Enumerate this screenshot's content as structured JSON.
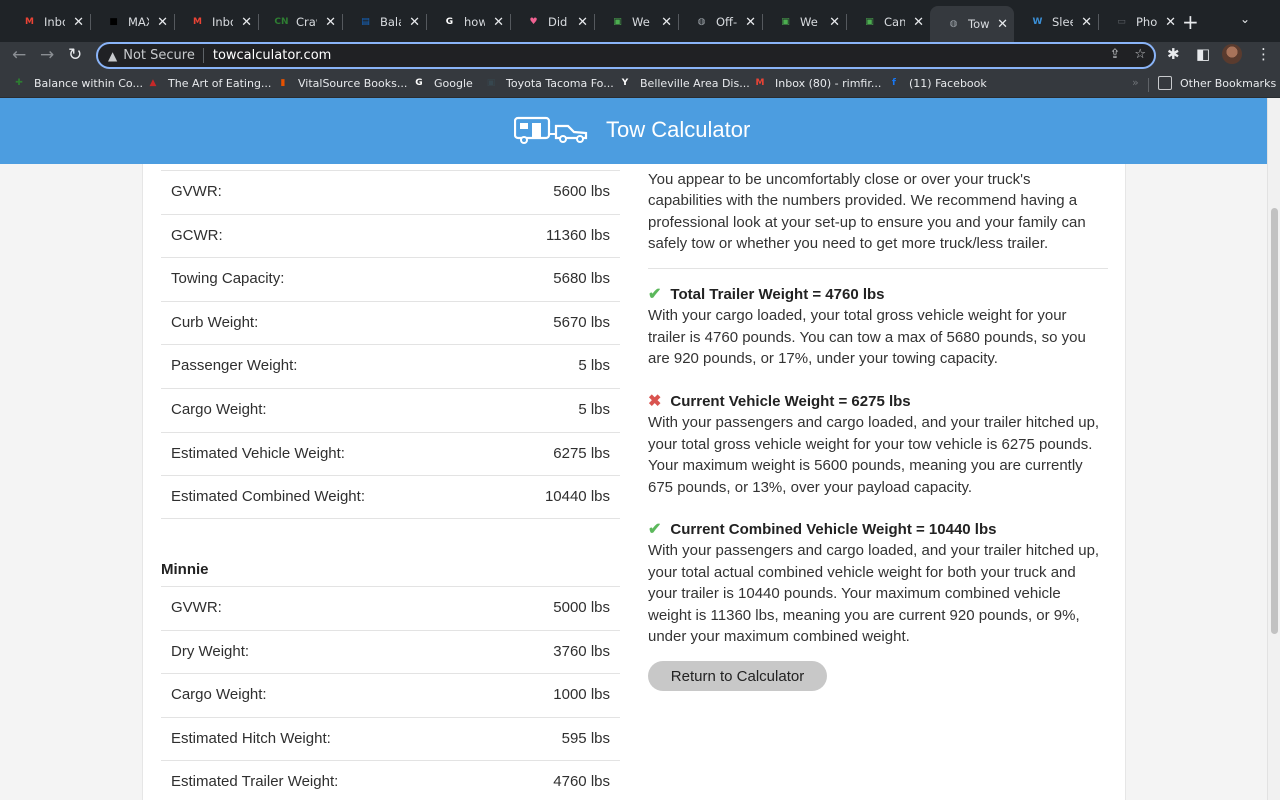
{
  "browser": {
    "tabs": [
      {
        "title": "Inbox",
        "icon": "gmail-icon",
        "color": "#ea4335",
        "glyph": "M"
      },
      {
        "title": "MAX",
        "icon": "max-icon",
        "color": "#000000",
        "glyph": "■"
      },
      {
        "title": "Inbox",
        "icon": "gmail-icon",
        "color": "#ea4335",
        "glyph": "M"
      },
      {
        "title": "Craw",
        "icon": "cn-icon",
        "color": "#2e7d32",
        "glyph": "CN"
      },
      {
        "title": "Balan",
        "icon": "doc-icon",
        "color": "#1565c0",
        "glyph": "▤"
      },
      {
        "title": "how t",
        "icon": "google-icon",
        "color": "#ffffff",
        "glyph": "G"
      },
      {
        "title": "Did y",
        "icon": "heart-icon",
        "color": "#f06292",
        "glyph": "♥"
      },
      {
        "title": "We ju",
        "icon": "image-icon",
        "color": "#4caf50",
        "glyph": "▣"
      },
      {
        "title": "Off-R",
        "icon": "globe-icon",
        "color": "#9aa0a6",
        "glyph": "◍"
      },
      {
        "title": "We ju",
        "icon": "image-icon",
        "color": "#4caf50",
        "glyph": "▣"
      },
      {
        "title": "Can a",
        "icon": "image-icon",
        "color": "#4caf50",
        "glyph": "▣"
      },
      {
        "title": "TowC",
        "icon": "globe-icon",
        "color": "#9aa0a6",
        "glyph": "◍",
        "active": true
      },
      {
        "title": "Sleep",
        "icon": "wordpress-icon",
        "color": "#3b8fd6",
        "glyph": "W"
      },
      {
        "title": "Photo",
        "icon": "photo-icon",
        "color": "#5f6368",
        "glyph": "▭"
      }
    ],
    "security_label": "Not Secure",
    "url": "towcalculator.com",
    "bookmarks": [
      {
        "label": "Balance within Co...",
        "color": "#2e7d32",
        "glyph": "✚"
      },
      {
        "label": "The Art of Eating...",
        "color": "#c62828",
        "glyph": "▲"
      },
      {
        "label": "VitalSource Books...",
        "color": "#e65100",
        "glyph": "▮"
      },
      {
        "label": "Google",
        "color": "#ffffff",
        "glyph": "G"
      },
      {
        "label": "Toyota Tacoma Fo...",
        "color": "#37474f",
        "glyph": "▣"
      },
      {
        "label": "Belleville Area Dis...",
        "color": "#ffffff",
        "glyph": "Y"
      },
      {
        "label": "Inbox (80) - rimfir...",
        "color": "#ea4335",
        "glyph": "M"
      },
      {
        "label": "(11) Facebook",
        "color": "#1877f2",
        "glyph": "f"
      }
    ],
    "other_bookmarks": "Other Bookmarks"
  },
  "site": {
    "brand": "Tow Calculator",
    "accent_color": "#4c9de0"
  },
  "truck_table": [
    {
      "label": "GVWR:",
      "value": "5600 lbs"
    },
    {
      "label": "GCWR:",
      "value": "11360 lbs"
    },
    {
      "label": "Towing Capacity:",
      "value": "5680 lbs"
    },
    {
      "label": "Curb Weight:",
      "value": "5670 lbs"
    },
    {
      "label": "Passenger Weight:",
      "value": "5 lbs"
    },
    {
      "label": "Cargo Weight:",
      "value": "5 lbs"
    },
    {
      "label": "Estimated Vehicle Weight:",
      "value": "6275 lbs"
    },
    {
      "label": "Estimated Combined Weight:",
      "value": "10440 lbs"
    }
  ],
  "trailer_section": "Minnie",
  "trailer_table": [
    {
      "label": "GVWR:",
      "value": "5000 lbs"
    },
    {
      "label": "Dry Weight:",
      "value": "3760 lbs"
    },
    {
      "label": "Cargo Weight:",
      "value": "1000 lbs"
    },
    {
      "label": "Estimated Hitch Weight:",
      "value": "595 lbs"
    },
    {
      "label": "Estimated Trailer Weight:",
      "value": "4760 lbs"
    }
  ],
  "intro_text": "You appear to be uncomfortably close or over your truck's capabilities with the numbers provided. We recommend having a professional look at your set-up to ensure you and your family can safely tow or whether you need to get more truck/less trailer.",
  "results": [
    {
      "status": "ok",
      "heading": "Total Trailer Weight = 4760 lbs",
      "body": "With your cargo loaded, your total gross vehicle weight for your trailer is 4760 pounds. You can tow a max of 5680 pounds, so you are 920 pounds, or 17%, under your towing capacity."
    },
    {
      "status": "bad",
      "heading": "Current Vehicle Weight = 6275 lbs",
      "body": "With your passengers and cargo loaded, and your trailer hitched up, your total gross vehicle weight for your tow vehicle is 6275 pounds. Your maximum weight is 5600 pounds, meaning you are currently 675 pounds, or 13%, over your payload capacity."
    },
    {
      "status": "ok",
      "heading": "Current Combined Vehicle Weight = 10440 lbs",
      "body": "With your passengers and cargo loaded, and your trailer hitched up, your total actual combined vehicle weight for both your truck and your trailer is 10440 pounds. Your maximum combined vehicle weight is 11360 lbs, meaning you are current 920 pounds, or 9%, under your maximum combined weight."
    }
  ],
  "return_button": "Return to Calculator"
}
